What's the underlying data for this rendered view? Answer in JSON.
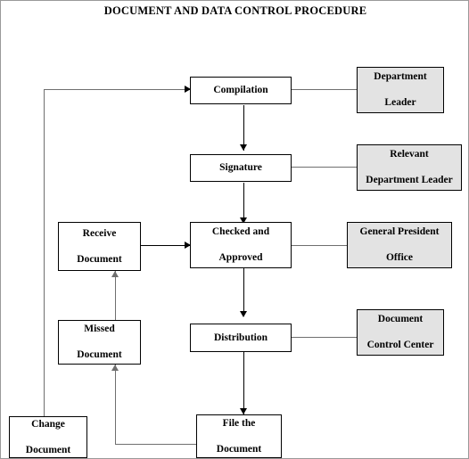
{
  "title": "DOCUMENT AND DATA CONTROL PROCEDURE",
  "colors": {
    "shaded_box": "#E3E3E3",
    "box_border": "#000000",
    "connector": "#6F6F6F",
    "background": "#FFFFFF"
  },
  "nodes": {
    "compilation": {
      "label": "Compilation",
      "shaded": false
    },
    "department_leader": {
      "label": "Department\nLeader",
      "line1": "Department",
      "line2": "Leader",
      "shaded": true
    },
    "signature": {
      "label": "Signature",
      "shaded": false
    },
    "relevant_department_leader": {
      "label": "Relevant\nDepartment Leader",
      "line1": "Relevant",
      "line2": "Department Leader",
      "shaded": true
    },
    "receive_document": {
      "label": "Receive\nDocument",
      "line1": "Receive",
      "line2": "Document",
      "shaded": false
    },
    "checked_and_approved": {
      "label": "Checked and\nApproved",
      "line1": "Checked and",
      "line2": "Approved",
      "shaded": false
    },
    "general_president_office": {
      "label": "General President\nOffice",
      "line1": "General President",
      "line2": "Office",
      "shaded": true
    },
    "missed_document": {
      "label": "Missed\nDocument",
      "line1": "Missed",
      "line2": "Document",
      "shaded": false
    },
    "distribution": {
      "label": "Distribution",
      "shaded": false
    },
    "document_control_center": {
      "label": "Document\nControl Center",
      "line1": "Document",
      "line2": "Control Center",
      "shaded": true
    },
    "change_document": {
      "label": "Change\nDocument",
      "line1": "Change",
      "line2": "Document",
      "shaded": false
    },
    "file_the_document": {
      "label": "File the\nDocument",
      "line1": "File the",
      "line2": "Document",
      "shaded": false
    }
  },
  "flow": [
    {
      "from": "compilation",
      "to": "signature",
      "type": "arrow-down"
    },
    {
      "from": "compilation",
      "to": "department_leader",
      "type": "line-right"
    },
    {
      "from": "signature",
      "to": "checked_and_approved",
      "type": "arrow-down"
    },
    {
      "from": "signature",
      "to": "relevant_department_leader",
      "type": "line-right"
    },
    {
      "from": "checked_and_approved",
      "to": "general_president_office",
      "type": "line-right"
    },
    {
      "from": "receive_document",
      "to": "checked_and_approved",
      "type": "arrow-right"
    },
    {
      "from": "missed_document",
      "to": "receive_document",
      "type": "arrow-up"
    },
    {
      "from": "checked_and_approved",
      "to": "distribution",
      "type": "arrow-down"
    },
    {
      "from": "distribution",
      "to": "document_control_center",
      "type": "line-right"
    },
    {
      "from": "distribution",
      "to": "file_the_document",
      "type": "arrow-down"
    },
    {
      "from": "file_the_document",
      "to": "missed_document",
      "type": "arrow-up-left"
    },
    {
      "from": "change_document",
      "to": "compilation",
      "type": "arrow-up-right"
    }
  ]
}
